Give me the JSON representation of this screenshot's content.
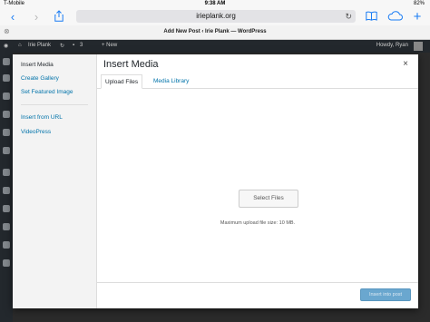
{
  "status_bar": {
    "carrier": "T-Mobile ",
    "time": "9:38 AM",
    "battery": "82%"
  },
  "browser": {
    "url": "irieplank.org",
    "tab_title": "Add New Post ‹ Irie Plank — WordPress"
  },
  "admin_bar": {
    "site_name": "Irie Plank",
    "comments": "3",
    "new_label": "+ New",
    "howdy": "Howdy, Ryan"
  },
  "modal": {
    "menu": {
      "insert_media": "Insert Media",
      "create_gallery": "Create Gallery",
      "set_featured_image": "Set Featured Image",
      "insert_from_url": "Insert from URL",
      "videopress": "VideoPress"
    },
    "title": "Insert Media",
    "close_glyph": "×",
    "tabs": {
      "upload_files": "Upload Files",
      "media_library": "Media Library"
    },
    "select_files_label": "Select Files",
    "max_upload": "Maximum upload file size: 10 MB.",
    "insert_button": "Insert into post"
  }
}
